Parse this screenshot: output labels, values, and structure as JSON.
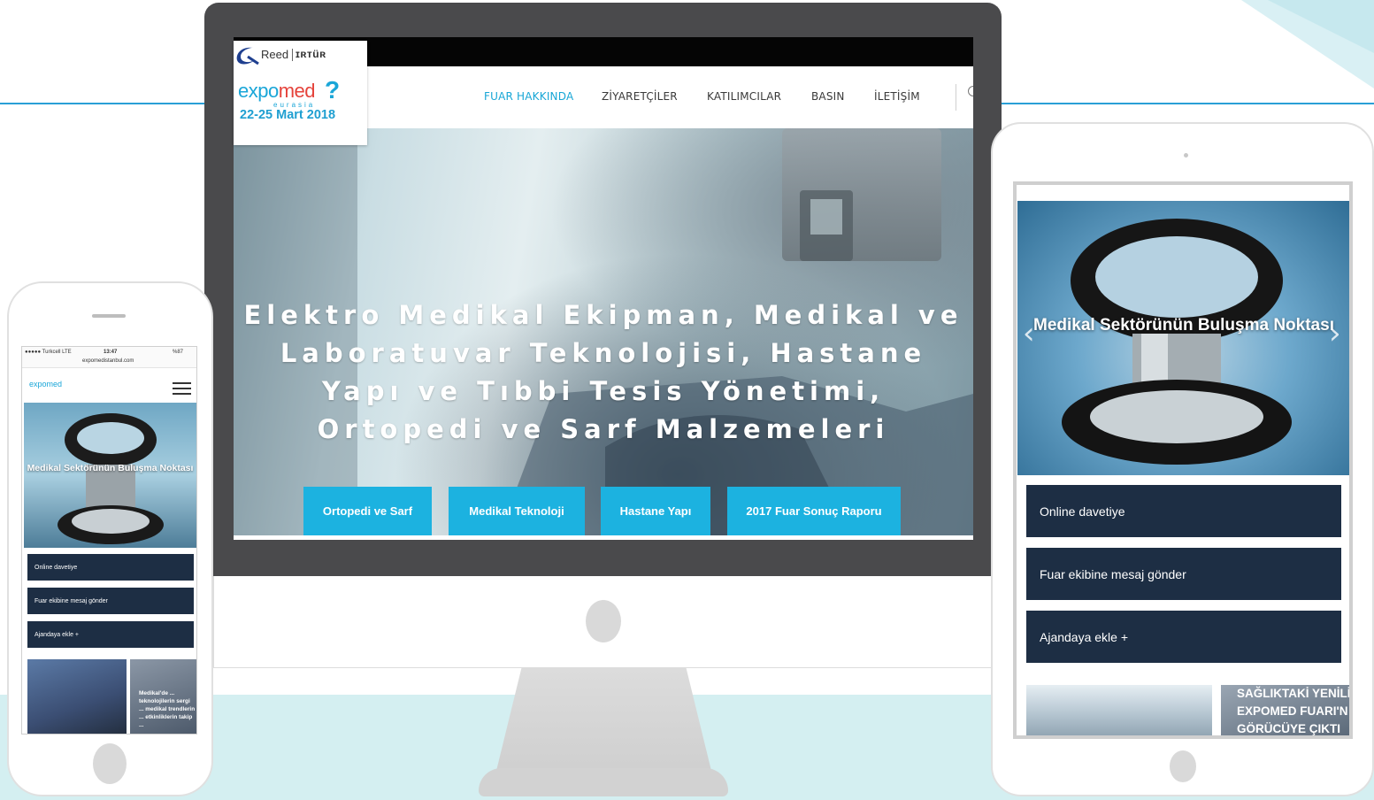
{
  "desktop": {
    "logo": {
      "reed": "Reed",
      "tur": "ɪʀᴛüʀ",
      "brand_expo": "expo",
      "brand_med": "med",
      "brand_suffix": "eurasia",
      "date": "22-25 Mart 2018"
    },
    "nav": {
      "items": [
        {
          "label": "FUAR HAKKINDA",
          "active": true
        },
        {
          "label": "ZİYARETÇİLER",
          "active": false
        },
        {
          "label": "KATILIMCILAR",
          "active": false
        },
        {
          "label": "BASIN",
          "active": false
        },
        {
          "label": "İLETİŞİM",
          "active": false
        }
      ]
    },
    "hero": {
      "title": "Elektro Medikal Ekipman, Medikal ve Laboratuvar Teknolojisi, Hastane Yapı ve Tıbbi Tesis Yönetimi, Ortopedi ve Sarf Malzemeleri",
      "buttons": [
        "Ortopedi ve Sarf",
        "Medikal Teknoloji",
        "Hastane Yapı",
        "2017 Fuar Sonuç Raporu"
      ]
    },
    "colors": {
      "accent": "#1cb2e0",
      "nav_active": "#17a6d6",
      "topbar": "#050505"
    }
  },
  "phone": {
    "status": {
      "carrier": "●●●●● Turkcell  LTE",
      "time": "13:47",
      "battery": "%87",
      "url": "expomedistanbul.com"
    },
    "logo": "expomed",
    "hero_title": "Medikal Sektörünün Buluşma Noktası",
    "buttons": [
      "Online davetiye",
      "Fuar ekibine mesaj gönder",
      "Ajandaya ekle +"
    ],
    "news_snippet": "Medikal'de ... teknolojilerin sergi ... medikal trendlerin ... etkinliklerin takip ..."
  },
  "tablet": {
    "hero_title": "Medikal Sektörünün Buluşma Noktası",
    "buttons": [
      "Online davetiye",
      "Fuar ekibine mesaj gönder",
      "Ajandaya ekle +"
    ],
    "news_headline": "SAĞLIKTAKİ YENİLİ EXPOMED FUARI'N GÖRÜCÜYE ÇIKTI",
    "colors": {
      "button_bg": "#1d2e44"
    }
  }
}
